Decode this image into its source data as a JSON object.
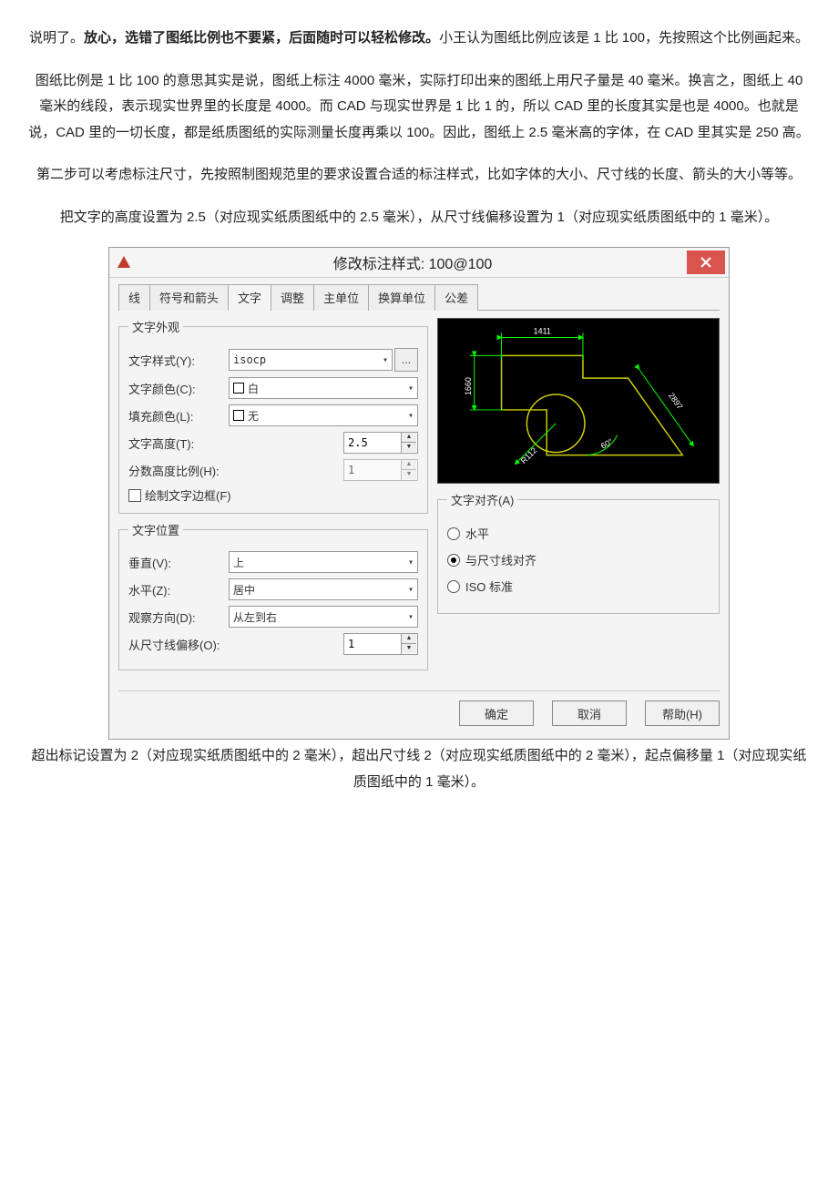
{
  "paragraphs": {
    "p1_prefix": "说明了。",
    "p1_bold": "放心，选错了图纸比例也不要紧，后面随时可以轻松修改。",
    "p1_suffix": "小王认为图纸比例应该是 1 比 100，先按照这个比例画起来。",
    "p2": "图纸比例是 1 比 100 的意思其实是说，图纸上标注 4000 毫米，实际打印出来的图纸上用尺子量是 40 毫米。换言之，图纸上 40 毫米的线段，表示现实世界里的长度是 4000。而 CAD 与现实世界是 1 比 1 的，所以 CAD 里的长度其实是也是 4000。也就是说，CAD 里的一切长度，都是纸质图纸的实际测量长度再乘以 100。因此，图纸上 2.5 毫米高的字体，在 CAD 里其实是 250 高。",
    "p3": "第二步可以考虑标注尺寸，先按照制图规范里的要求设置合适的标注样式，比如字体的大小、尺寸线的长度、箭头的大小等等。",
    "p4": "把文字的高度设置为 2.5（对应现实纸质图纸中的 2.5 毫米），从尺寸线偏移设置为 1（对应现实纸质图纸中的 1 毫米）。"
  },
  "dialog": {
    "title": "修改标注样式: 100@100",
    "tabs": [
      "线",
      "符号和箭头",
      "文字",
      "调整",
      "主单位",
      "换算单位",
      "公差"
    ],
    "active_tab": 2,
    "group_appearance": {
      "legend": "文字外观",
      "text_style_label": "文字样式(Y):",
      "text_style_value": "isocp",
      "text_color_label": "文字颜色(C):",
      "text_color_value": "白",
      "fill_color_label": "填充颜色(L):",
      "fill_color_value": "无",
      "text_height_label": "文字高度(T):",
      "text_height_value": "2.5",
      "frac_scale_label": "分数高度比例(H):",
      "frac_scale_value": "1",
      "draw_frame_label": "绘制文字边框(F)"
    },
    "group_position": {
      "legend": "文字位置",
      "vertical_label": "垂直(V):",
      "vertical_value": "上",
      "horizontal_label": "水平(Z):",
      "horizontal_value": "居中",
      "view_dir_label": "观察方向(D):",
      "view_dir_value": "从左到右",
      "offset_label": "从尺寸线偏移(O):",
      "offset_value": "1"
    },
    "group_align": {
      "legend": "文字对齐(A)",
      "opt_horizontal": "水平",
      "opt_aligned": "与尺寸线对齐",
      "opt_iso": "ISO 标准"
    },
    "preview_dims": {
      "top": "1411",
      "left": "1660",
      "diag": "2897",
      "angle": "60°",
      "radius": "R112"
    },
    "buttons": {
      "ok": "确定",
      "cancel": "取消",
      "help": "帮助(H)"
    }
  },
  "caption": "超出标记设置为 2（对应现实纸质图纸中的 2 毫米），超出尺寸线 2（对应现实纸质图纸中的 2 毫米），起点偏移量 1（对应现实纸质图纸中的 1 毫米）。"
}
